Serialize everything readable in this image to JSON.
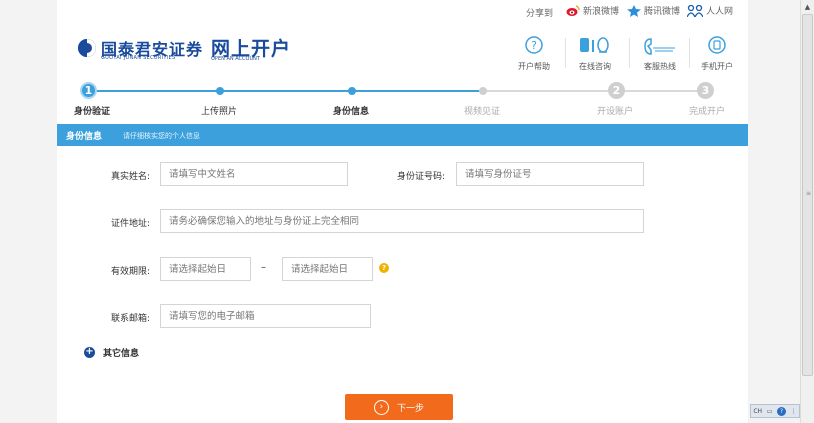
{
  "share": {
    "label": "分享到",
    "items": [
      {
        "label": "新浪微博",
        "icon": "sina-weibo-icon"
      },
      {
        "label": "腾讯微博",
        "icon": "tencent-weibo-icon"
      },
      {
        "label": "人人网",
        "icon": "renren-icon"
      }
    ]
  },
  "header": {
    "logo_text": "国泰君安证券",
    "logo_sub": "GUOTAI JUNAN SECURITIES",
    "brand_text": "网上开户",
    "brand_sub": "OPEN AN ACCOUNT",
    "tools": [
      {
        "label": "开户帮助",
        "icon": "help-icon"
      },
      {
        "label": "在线咨询",
        "icon": "online-chat-icon"
      },
      {
        "label": "客服热线",
        "icon": "hotline-icon"
      },
      {
        "label": "手机开户",
        "icon": "mobile-icon"
      }
    ]
  },
  "steps": [
    {
      "label": "身份验证",
      "number": "1",
      "state": "active"
    },
    {
      "label": "上传照片",
      "state": "done"
    },
    {
      "label": "身份信息",
      "state": "done"
    },
    {
      "label": "视频见证",
      "state": "pending"
    },
    {
      "label": "开设账户",
      "number": "2",
      "state": "pending"
    },
    {
      "label": "完成开户",
      "number": "3",
      "state": "pending"
    }
  ],
  "section": {
    "title": "身份信息",
    "hint": "请仔细核实您的个人信息"
  },
  "form": {
    "name_label": "真实姓名:",
    "name_placeholder": "请填写中文姓名",
    "id_label": "身份证号码:",
    "id_placeholder": "请填写身份证号",
    "address_label": "证件地址:",
    "address_placeholder": "请务必确保您输入的地址与身份证上完全相同",
    "validity_label": "有效期限:",
    "validity_start_placeholder": "请选择起始日",
    "validity_dash": "–",
    "validity_end_placeholder": "请选择起始日",
    "email_label": "联系邮箱:",
    "email_placeholder": "请填写您的电子邮箱"
  },
  "more_info": {
    "label": "其它信息"
  },
  "next_button": {
    "label": "下一步"
  },
  "ime": {
    "mode": "CH",
    "help": "?"
  },
  "colors": {
    "accent": "#3ba0dc",
    "brand": "#1a4b9c",
    "button": "#f26b1d",
    "hint_icon": "#f0b400"
  }
}
